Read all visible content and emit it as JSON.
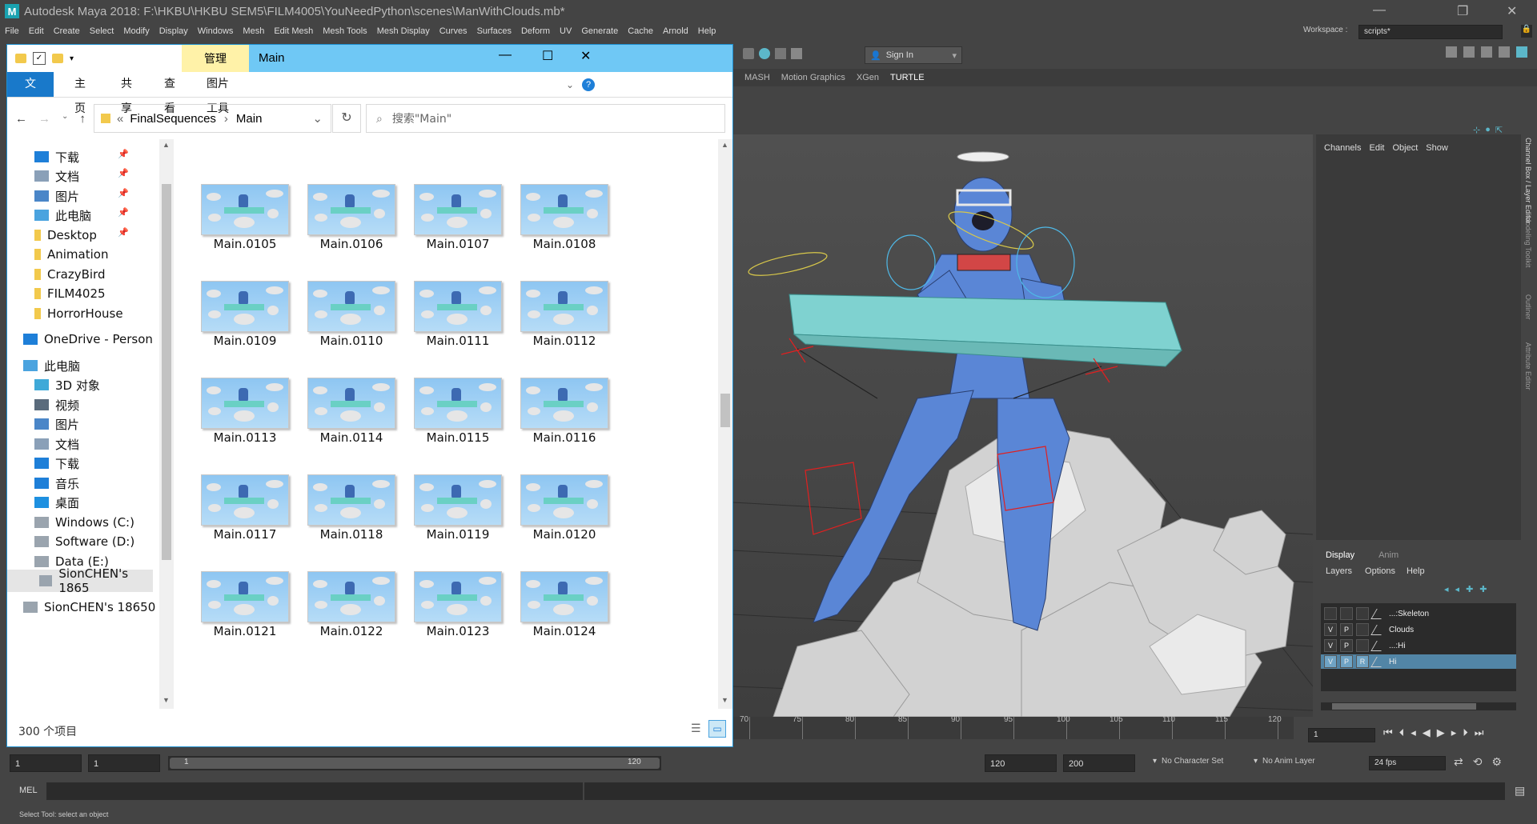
{
  "maya": {
    "title": "Autodesk Maya 2018: F:\\HKBU\\HKBU SEM5\\FILM4005\\YouNeedPython\\scenes\\ManWithClouds.mb*",
    "menus": [
      "File",
      "Edit",
      "Create",
      "Select",
      "Modify",
      "Display",
      "Windows",
      "Mesh",
      "Edit Mesh",
      "Mesh Tools",
      "Mesh Display",
      "Curves",
      "Surfaces",
      "Deform",
      "UV",
      "Generate",
      "Cache",
      "Arnold",
      "Help"
    ],
    "workspace_label": "Workspace :",
    "workspace_value": "scripts*",
    "sign_in": "Sign In",
    "shelf_tabs": [
      "MASH",
      "Motion Graphics",
      "XGen",
      "TURTLE"
    ],
    "channel_box_menus": [
      "Channels",
      "Edit",
      "Object",
      "Show"
    ],
    "right_vtabs": [
      "Channel Box / Layer Editor",
      "Modeling Toolkit",
      "Outliner",
      "Attribute Editor"
    ],
    "layer_tabs": [
      "Display",
      "Anim"
    ],
    "layer_menus": [
      "Layers",
      "Options",
      "Help"
    ],
    "layers": [
      {
        "v": "",
        "p": "",
        "r": "",
        "name": "...:Skeleton",
        "selected": false
      },
      {
        "v": "V",
        "p": "P",
        "r": "",
        "name": "Clouds",
        "selected": false
      },
      {
        "v": "V",
        "p": "P",
        "r": "",
        "name": "...:Hi",
        "selected": false
      },
      {
        "v": "V",
        "p": "P",
        "r": "R",
        "name": "Hi",
        "selected": true
      }
    ],
    "timeline_ticks": [
      "70",
      "75",
      "80",
      "85",
      "90",
      "95",
      "100",
      "105",
      "110",
      "115",
      "120"
    ],
    "current_frame": "1",
    "range": {
      "start": "1",
      "start2": "1",
      "slider_start": "1",
      "slider_end": "120",
      "end": "120",
      "end2": "200"
    },
    "no_character_set": "No Character Set",
    "no_anim_layer": "No Anim Layer",
    "fps": "24 fps",
    "mel_label": "MEL",
    "help_line": "Select Tool: select an object"
  },
  "explorer": {
    "quick_tab": "管理",
    "window_title": "Main",
    "tabs": [
      "文件",
      "主页",
      "共享",
      "查看",
      "图片工具"
    ],
    "breadcrumb_prefix": "«",
    "breadcrumb": [
      "FinalSequences",
      "Main"
    ],
    "search_placeholder": "搜索\"Main\"",
    "nav_items": [
      {
        "label": "下载",
        "icon": "download-icon",
        "pinned": true
      },
      {
        "label": "文档",
        "icon": "document-icon",
        "pinned": true
      },
      {
        "label": "图片",
        "icon": "picture-icon",
        "pinned": true
      },
      {
        "label": "此电脑",
        "icon": "computer-icon",
        "pinned": true
      },
      {
        "label": "Desktop",
        "icon": "folder-icon",
        "pinned": true
      },
      {
        "label": "Animation",
        "icon": "folder-icon",
        "pinned": false
      },
      {
        "label": "CrazyBird",
        "icon": "folder-icon",
        "pinned": false
      },
      {
        "label": "FILM4025",
        "icon": "folder-icon",
        "pinned": false
      },
      {
        "label": "HorrorHouse",
        "icon": "folder-icon",
        "pinned": false
      },
      {
        "label": "OneDrive - Person",
        "icon": "cloud-icon",
        "pinned": false
      },
      {
        "label": "此电脑",
        "icon": "computer-icon",
        "pinned": false
      },
      {
        "label": "3D 对象",
        "icon": "cube-icon",
        "pinned": false
      },
      {
        "label": "视频",
        "icon": "video-icon",
        "pinned": false
      },
      {
        "label": "图片",
        "icon": "picture-icon",
        "pinned": false
      },
      {
        "label": "文档",
        "icon": "document-icon",
        "pinned": false
      },
      {
        "label": "下载",
        "icon": "download-icon",
        "pinned": false
      },
      {
        "label": "音乐",
        "icon": "music-icon",
        "pinned": false
      },
      {
        "label": "桌面",
        "icon": "desktop-icon",
        "pinned": false
      },
      {
        "label": "Windows (C:)",
        "icon": "drive-icon",
        "pinned": false
      },
      {
        "label": "Software (D:)",
        "icon": "drive-icon",
        "pinned": false
      },
      {
        "label": "Data (E:)",
        "icon": "drive-icon",
        "pinned": false
      },
      {
        "label": "SionCHEN's 1865",
        "icon": "drive-icon",
        "pinned": false
      },
      {
        "label": "SionCHEN's 18650",
        "icon": "drive-icon",
        "pinned": false
      }
    ],
    "files": [
      "Main.0105",
      "Main.0106",
      "Main.0107",
      "Main.0108",
      "Main.0109",
      "Main.0110",
      "Main.0111",
      "Main.0112",
      "Main.0113",
      "Main.0114",
      "Main.0115",
      "Main.0116",
      "Main.0117",
      "Main.0118",
      "Main.0119",
      "Main.0120",
      "Main.0121",
      "Main.0122",
      "Main.0123",
      "Main.0124"
    ],
    "status": "300 个项目"
  }
}
